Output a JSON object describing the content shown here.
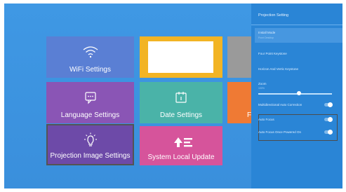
{
  "tiles": {
    "wifi": {
      "label": "WiFi Settings",
      "icon": "wifi-icon",
      "color": "#5a7fd4"
    },
    "language": {
      "label": "Language Settings",
      "icon": "message-icon",
      "color": "#8a55b5"
    },
    "date": {
      "label": "Date Settings",
      "icon": "calendar-icon",
      "color": "#4ab3a8"
    },
    "factory": {
      "label": "Fa",
      "color": "#ef7a34"
    },
    "projection": {
      "label": "Projection Image Settings",
      "icon": "lightbulb-icon",
      "color": "#6d4aa8"
    },
    "system": {
      "label": "System Local Update",
      "icon": "update-icon",
      "color": "#d6549b"
    }
  },
  "panel": {
    "title": "Projection Setting",
    "install_mode": {
      "label": "Install Mode",
      "value": "Front Desktop"
    },
    "four_point": {
      "label": "Four Point Keystone"
    },
    "horizontal_vertical": {
      "label": "Horizon And Vertic Keystone"
    },
    "zoom": {
      "label": "Zoom",
      "value": "100%",
      "level_fraction": 0.55
    },
    "multidirectional": {
      "label": "Multidirectional Auto Correction",
      "on": true
    },
    "auto_focus": {
      "label": "Auto Focus",
      "on": true
    },
    "auto_focus_power": {
      "label": "Auto Focus Once Powered On",
      "on": true
    }
  },
  "colors": {
    "background": "#3a8fdc",
    "panel": "#2a85d6",
    "highlight": "#4797e0"
  }
}
